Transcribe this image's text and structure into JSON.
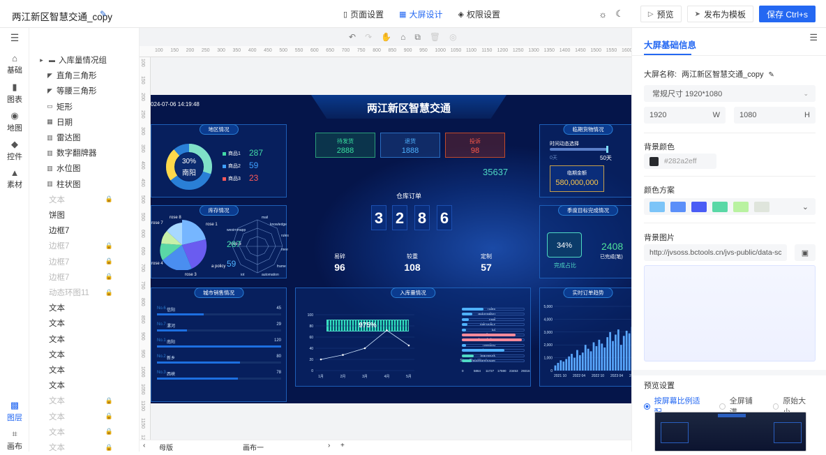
{
  "header": {
    "app_title": "两江新区智慧交通_copy",
    "tabs": [
      {
        "label": "页面设置",
        "icon": "bookmark-icon"
      },
      {
        "label": "大屏设计",
        "icon": "grid-icon"
      },
      {
        "label": "权限设置",
        "icon": "shield-icon"
      }
    ],
    "preview_label": "预览",
    "publish_label": "发布为模板",
    "save_label": "保存 Ctrl+s"
  },
  "rail": [
    {
      "label": "基础",
      "icon": "shapes-icon"
    },
    {
      "label": "图表",
      "icon": "bar-chart-icon"
    },
    {
      "label": "地图",
      "icon": "map-icon"
    },
    {
      "label": "控件",
      "icon": "widget-icon"
    },
    {
      "label": "素材",
      "icon": "material-icon"
    },
    {
      "label": "图层",
      "icon": "layers-icon"
    },
    {
      "label": "画布",
      "icon": "canvas-icon"
    }
  ],
  "layers": [
    {
      "label": "入库量情况组",
      "icon": "folder-icon",
      "dim": false
    },
    {
      "label": "直角三角形",
      "icon": "triangle-icon",
      "dim": false
    },
    {
      "label": "等腰三角形",
      "icon": "triangle-icon",
      "dim": false
    },
    {
      "label": "矩形",
      "icon": "rect-icon",
      "dim": false
    },
    {
      "label": "日期",
      "icon": "calendar-icon",
      "dim": false
    },
    {
      "label": "雷达图",
      "icon": "chart-icon",
      "dim": false
    },
    {
      "label": "数字翻牌器",
      "icon": "chart-icon",
      "dim": false
    },
    {
      "label": "水位图",
      "icon": "chart-icon",
      "dim": false
    },
    {
      "label": "柱状图",
      "icon": "chart-icon",
      "dim": false
    },
    {
      "label": "文本",
      "icon": "",
      "dim": true
    },
    {
      "label": "饼图",
      "icon": "",
      "dim": false
    },
    {
      "label": "边框7",
      "icon": "",
      "dim": false
    },
    {
      "label": "边框7",
      "icon": "",
      "dim": true
    },
    {
      "label": "边框7",
      "icon": "",
      "dim": true
    },
    {
      "label": "边框7",
      "icon": "",
      "dim": true
    },
    {
      "label": "动态环图11",
      "icon": "",
      "dim": true
    },
    {
      "label": "文本",
      "icon": "",
      "dim": false
    },
    {
      "label": "文本",
      "icon": "",
      "dim": false
    },
    {
      "label": "文本",
      "icon": "",
      "dim": false
    },
    {
      "label": "文本",
      "icon": "",
      "dim": false
    },
    {
      "label": "文本",
      "icon": "",
      "dim": false
    },
    {
      "label": "文本",
      "icon": "",
      "dim": false
    },
    {
      "label": "文本",
      "icon": "",
      "dim": true
    },
    {
      "label": "文本",
      "icon": "",
      "dim": true
    },
    {
      "label": "文本",
      "icon": "",
      "dim": true
    },
    {
      "label": "文本",
      "icon": "",
      "dim": true
    }
  ],
  "ruler": {
    "top": [
      "100",
      "150",
      "200",
      "250",
      "300",
      "350",
      "400",
      "450",
      "500",
      "550",
      "600",
      "650",
      "700",
      "750",
      "800",
      "850",
      "900",
      "950",
      "1000",
      "1050",
      "1100",
      "1150",
      "1200",
      "1250",
      "1300",
      "1350",
      "1400",
      "1450",
      "1500",
      "1550",
      "1600",
      "1650"
    ],
    "left": [
      "100",
      "150",
      "200",
      "250",
      "300",
      "350",
      "400",
      "450",
      "500",
      "550",
      "600",
      "650",
      "700",
      "750",
      "800",
      "850",
      "900",
      "950",
      "1000",
      "1050",
      "1100",
      "1150",
      "1200"
    ]
  },
  "dashboard": {
    "title": "两江新区智慧交通",
    "time": "024-07-06 14:19:48",
    "region": {
      "title": "地区情况",
      "center_pct": "30%",
      "center_name": "南阳",
      "items": [
        {
          "name": "商品1",
          "value": "287",
          "color": "#42d9a6"
        },
        {
          "name": "商品2",
          "value": "59",
          "color": "#3fa0ff"
        },
        {
          "name": "商品3",
          "value": "23",
          "color": "#ff5a5a"
        }
      ]
    },
    "stock": {
      "title": "库存情况",
      "labels": [
        "rose 8",
        "rose 7",
        "rose 1",
        "rose 4",
        "rose 3",
        "rose 5",
        "a policy"
      ],
      "radar_labels": [
        "mail",
        "knowledge",
        "rules",
        "mee",
        "frame",
        "automation",
        "iot",
        "weoirnmapp"
      ],
      "values": [
        "287",
        "59"
      ]
    },
    "kpis": [
      {
        "label": "待发货",
        "value": "2888",
        "color": "#39e0a0",
        "border": "#2b9f7a"
      },
      {
        "label": "退货",
        "value": "1888",
        "color": "#4fb2ff",
        "border": "#2b6fc2"
      },
      {
        "label": "投诉",
        "value": "98",
        "color": "#ff5a4a",
        "border": "#c24a2b"
      }
    ],
    "big_number": "35637",
    "order_title": "仓库订单",
    "digits": [
      "3",
      "2",
      "8",
      "6"
    ],
    "stats": [
      {
        "label": "易碎",
        "value": "96"
      },
      {
        "label": "较重",
        "value": "108"
      },
      {
        "label": "定制",
        "value": "57"
      }
    ],
    "cargo": {
      "title": "临期货物情况",
      "slider_label": "时间动态选择",
      "slider_min": "0天",
      "slider_value": "50天",
      "amount_label": "临期金额",
      "amount": "580,000,000"
    },
    "target": {
      "title": "季度目标完成情况",
      "pct": "34%",
      "pct_label": "完成占比",
      "done": "2408",
      "done_label": "已完成(笔)"
    },
    "city": {
      "title": "城市销售情况",
      "rows": [
        {
          "rank": "No.6",
          "name": "信阳",
          "value": "45"
        },
        {
          "rank": "No.7",
          "name": "漯河",
          "value": "29"
        },
        {
          "rank": "No.1",
          "name": "南阳",
          "value": "120"
        },
        {
          "rank": "No.2",
          "name": "新乡",
          "value": "80"
        },
        {
          "rank": "No.3",
          "name": "西峡",
          "value": "78"
        }
      ]
    },
    "inbound": {
      "title": "入库量情况",
      "progress": "975%",
      "bar_labels": [
        "rules",
        "automation",
        "mail",
        "risk-policy",
        "iot",
        "frame",
        "knowledge",
        "meeting",
        "weoirnmapp",
        "teamwork",
        "StoredDataWarehouse"
      ],
      "x_ticks": [
        "0",
        "5864",
        "11727",
        "17590",
        "23453",
        "29316"
      ]
    },
    "realtime": {
      "title": "实时订单趋势",
      "y_ticks": [
        "5,000",
        "4,000",
        "3,000",
        "2,000",
        "1,000",
        "0"
      ],
      "x_ticks": [
        "2021 10",
        "2022 04",
        "2022 10",
        "2023 04",
        "20"
      ]
    }
  },
  "chart_data": [
    {
      "type": "line",
      "categories": [
        "1月",
        "2月",
        "3月",
        "4月",
        "5月"
      ],
      "values": [
        20,
        28,
        40,
        72,
        45
      ],
      "ylim": [
        0,
        100
      ],
      "y_ticks": [
        0,
        20,
        40,
        60,
        80,
        100
      ]
    },
    {
      "type": "bar",
      "categories": [
        "rules",
        "automation",
        "mail",
        "risk-policy",
        "iot",
        "frame",
        "knowledge",
        "meeting",
        "weoirnmapp",
        "teamwork",
        "StoredDataWarehouse"
      ],
      "values": [
        10000,
        5000,
        3200,
        2600,
        1800,
        25000,
        28000,
        2000,
        20000,
        5500,
        4500
      ],
      "xlim": [
        0,
        29316
      ]
    },
    {
      "type": "bar",
      "categories_range": [
        "2021 10",
        "2023 04"
      ],
      "values": [
        400,
        600,
        800,
        700,
        900,
        1100,
        1300,
        1000,
        1600,
        1200,
        1400,
        2000,
        1700,
        1500,
        2200,
        1900,
        2400,
        2100,
        1800,
        2600,
        3000,
        2300,
        2800,
        3200,
        2000,
        2700,
        3100,
        2900,
        3400
      ],
      "ylim": [
        0,
        5000
      ]
    }
  ],
  "right_panel": {
    "title": "大屏基础信息",
    "name_label": "大屏名称:",
    "name_value": "两江新区智慧交通_copy",
    "size_select": "常规尺寸 1920*1080",
    "width": "1920",
    "width_unit": "W",
    "height": "1080",
    "height_unit": "H",
    "bg_color_label": "背景颜色",
    "bg_color": "#282a2eff",
    "bg_color_swatch": "#282a2e",
    "scheme_label": "颜色方案",
    "scheme_colors": [
      "#7cc4f8",
      "#5b8ff9",
      "#4a5cf5",
      "#5ad8a6",
      "#b9f2a1",
      "#dfe5dc"
    ],
    "bg_image_label": "背景图片",
    "bg_image_url": "http://jvsoss.bctools.cn/jvs-public/data-sc",
    "preview_label": "预览设置",
    "preview_options": [
      {
        "label": "按屏幕比例适配",
        "on": true
      },
      {
        "label": "全屏铺满",
        "on": false
      },
      {
        "label": "原始大小",
        "on": false
      }
    ]
  },
  "canvas_tabs": {
    "mother": "母版",
    "canvas1": "画布一"
  }
}
